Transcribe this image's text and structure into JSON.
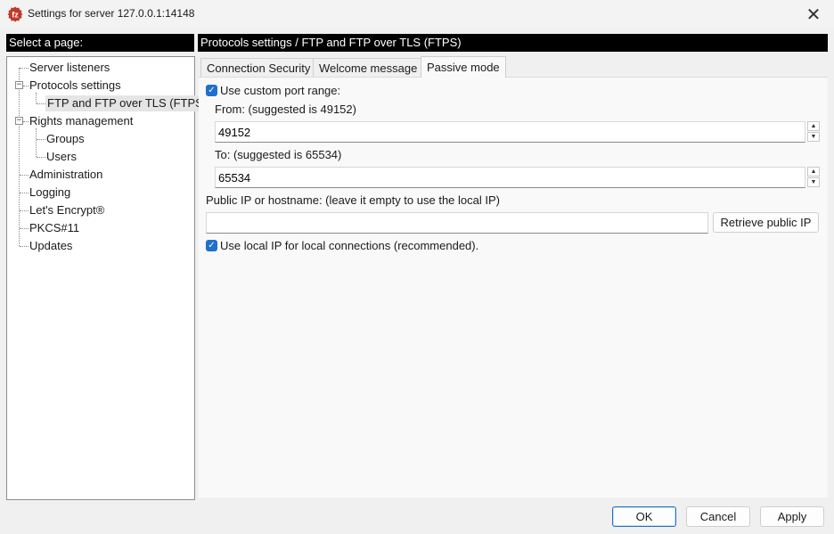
{
  "window": {
    "title": "Settings for server 127.0.0.1:14148",
    "close_glyph": "✕"
  },
  "left_header": "Select a page:",
  "right_header": "Protocols settings / FTP and FTP over TLS (FTPS)",
  "tree": {
    "items": [
      {
        "label": "Server listeners"
      },
      {
        "label": "Protocols settings"
      },
      {
        "label": "FTP and FTP over TLS (FTPS)"
      },
      {
        "label": "Rights management"
      },
      {
        "label": "Groups"
      },
      {
        "label": "Users"
      },
      {
        "label": "Administration"
      },
      {
        "label": "Logging"
      },
      {
        "label": "Let's Encrypt®"
      },
      {
        "label": "PKCS#11"
      },
      {
        "label": "Updates"
      }
    ],
    "expander_glyph": "−"
  },
  "tabs": [
    {
      "label": "Connection Security"
    },
    {
      "label": "Welcome message"
    },
    {
      "label": "Passive mode"
    }
  ],
  "passive": {
    "custom_range_label": "Use custom port range:",
    "from_label": "From: (suggested is 49152)",
    "from_value": "49152",
    "to_label": "To: (suggested is 65534)",
    "to_value": "65534",
    "public_ip_label": "Public IP or hostname: (leave it empty to use the local IP)",
    "public_ip_value": "",
    "retrieve_label": "Retrieve public IP",
    "local_ip_label": "Use local IP for local connections (recommended).",
    "check_glyph": "✓",
    "spin_up": "▲",
    "spin_down": "▼"
  },
  "footer": {
    "ok": "OK",
    "cancel": "Cancel",
    "apply": "Apply"
  },
  "colors": {
    "accent": "#1f6fcf",
    "header_bg": "#000000",
    "app_icon": "#c0392b"
  },
  "icons": {
    "app": "filezilla-server-icon",
    "close": "close-icon"
  }
}
